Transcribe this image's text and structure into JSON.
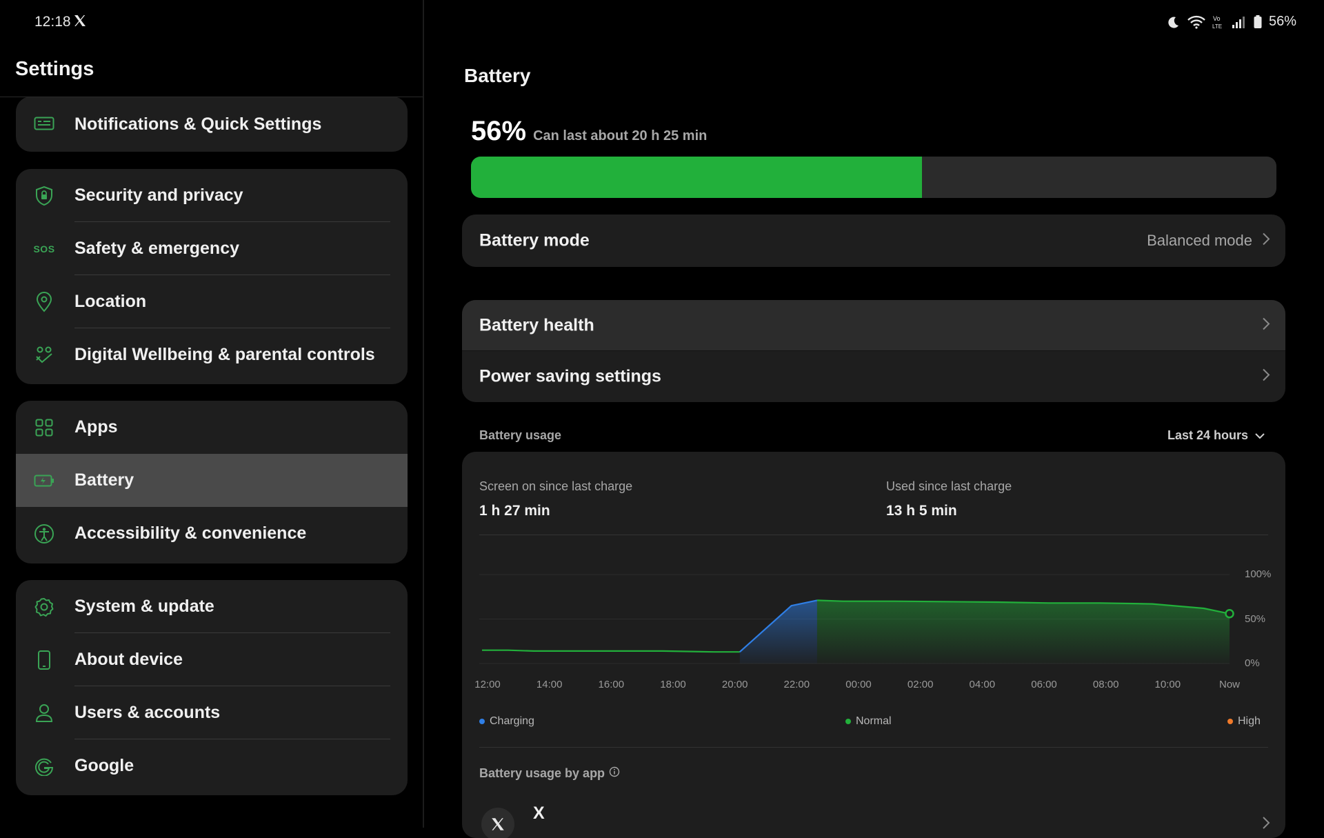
{
  "status_bar": {
    "time": "12:18",
    "notification_icon": "x-logo-icon",
    "icons": [
      "moon-icon",
      "wifi-icon",
      "volte-icon",
      "signal-icon",
      "battery-icon"
    ],
    "battery_text": "56%"
  },
  "left": {
    "title": "Settings",
    "groups": [
      {
        "items": [
          {
            "label": "Notifications & Quick Settings",
            "icon": "notifications-icon"
          }
        ]
      },
      {
        "items": [
          {
            "label": "Security and privacy",
            "icon": "shield-icon"
          },
          {
            "label": "Safety & emergency",
            "icon": "sos-icon",
            "icon_text": "SOS"
          },
          {
            "label": "Location",
            "icon": "location-pin-icon"
          },
          {
            "label": "Digital Wellbeing & parental controls",
            "icon": "wellbeing-icon"
          }
        ]
      },
      {
        "items": [
          {
            "label": "Apps",
            "icon": "apps-grid-icon"
          },
          {
            "label": "Battery",
            "icon": "battery-icon",
            "selected": true
          },
          {
            "label": "Accessibility & convenience",
            "icon": "accessibility-icon"
          }
        ]
      },
      {
        "items": [
          {
            "label": "System & update",
            "icon": "gear-icon"
          },
          {
            "label": "About device",
            "icon": "phone-icon"
          },
          {
            "label": "Users & accounts",
            "icon": "user-icon"
          },
          {
            "label": "Google",
            "icon": "google-icon"
          }
        ]
      }
    ]
  },
  "right": {
    "title": "Battery",
    "percent": "56%",
    "level": 0.56,
    "estimate": "Can last about 20 h 25 min",
    "battery_mode": {
      "label": "Battery mode",
      "value": "Balanced mode"
    },
    "rows": [
      {
        "label": "Battery health"
      },
      {
        "label": "Power saving settings"
      }
    ],
    "usage": {
      "header": "Battery usage",
      "range": "Last 24 hours",
      "screen_on_label": "Screen on since last charge",
      "screen_on_value": "1 h 27 min",
      "used_label": "Used since last charge",
      "used_value": "13 h 5 min",
      "legend": [
        "Charging",
        "Normal",
        "High"
      ],
      "by_app_label": "Battery usage by app",
      "app_name": "X"
    },
    "colors": {
      "normal": "#22b03b",
      "charging": "#2f7fe6",
      "high": "#f07a2a",
      "accent": "#3aa455"
    }
  },
  "chart_data": {
    "type": "area",
    "x_ticks": [
      "12:00",
      "14:00",
      "16:00",
      "18:00",
      "20:00",
      "22:00",
      "00:00",
      "02:00",
      "04:00",
      "06:00",
      "08:00",
      "10:00",
      "Now"
    ],
    "y_ticks": [
      "100%",
      "50%",
      "0%"
    ],
    "ylim": [
      0,
      100
    ],
    "series": [
      {
        "name": "Normal",
        "points": [
          [
            0,
            15
          ],
          [
            1,
            15
          ],
          [
            2,
            14
          ],
          [
            5,
            14
          ],
          [
            7,
            14
          ],
          [
            9,
            13
          ],
          [
            10,
            13
          ]
        ]
      },
      {
        "name": "Charging",
        "points": [
          [
            10,
            13
          ],
          [
            11,
            39
          ],
          [
            12,
            65
          ],
          [
            13,
            71
          ]
        ]
      },
      {
        "name": "Normal",
        "points": [
          [
            13,
            71
          ],
          [
            14,
            70
          ],
          [
            16,
            70
          ],
          [
            20,
            69
          ],
          [
            22,
            68
          ],
          [
            24,
            68
          ],
          [
            26,
            67
          ],
          [
            28,
            62
          ],
          [
            29,
            56
          ]
        ]
      }
    ],
    "legend": [
      "Charging",
      "Normal",
      "High"
    ],
    "current_value": 56
  }
}
